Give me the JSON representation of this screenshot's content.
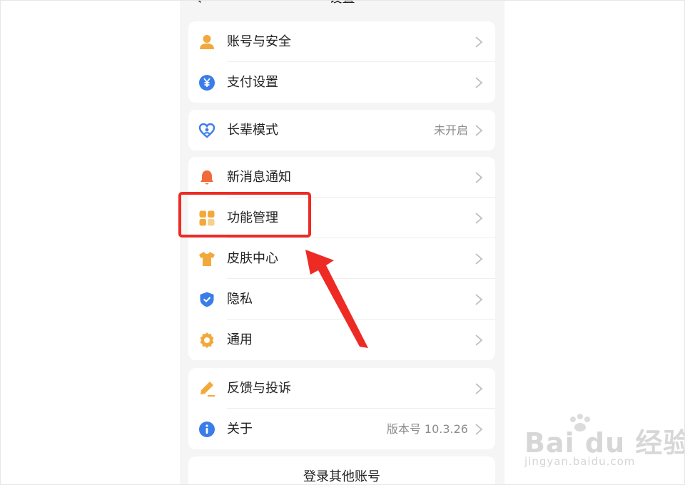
{
  "header": {
    "back_icon": "chevron-left-icon",
    "title": "设置"
  },
  "groups": [
    {
      "items": [
        {
          "label": "账号与安全",
          "icon": "user-icon",
          "color": "#f2a93b"
        },
        {
          "label": "支付设置",
          "icon": "yuan-circle-icon",
          "color": "#3b7de8"
        }
      ]
    },
    {
      "items": [
        {
          "label": "长辈模式",
          "value": "未开启",
          "icon": "heart-person-icon",
          "color": "#3b7de8"
        }
      ]
    },
    {
      "items": [
        {
          "label": "新消息通知",
          "icon": "bell-icon",
          "color": "#f06a3a"
        },
        {
          "label": "功能管理",
          "icon": "grid-icon",
          "color": "#f2a93b"
        },
        {
          "label": "皮肤中心",
          "icon": "tshirt-icon",
          "color": "#f2a93b"
        },
        {
          "label": "隐私",
          "icon": "shield-check-icon",
          "color": "#3b7de8"
        },
        {
          "label": "通用",
          "icon": "gear-icon",
          "color": "#f2a93b"
        }
      ]
    },
    {
      "items": [
        {
          "label": "反馈与投诉",
          "icon": "pencil-icon",
          "color": "#f2a93b"
        },
        {
          "label": "关于",
          "value": "版本号 10.3.26",
          "icon": "info-icon",
          "color": "#3b7de8"
        }
      ]
    }
  ],
  "login_other": "登录其他账号",
  "annotation": {
    "highlight_color": "#ee2a24",
    "highlighted_item": "功能管理"
  },
  "watermark": {
    "main": "Bai du 经验",
    "sub": "jingyan.baidu.com"
  }
}
